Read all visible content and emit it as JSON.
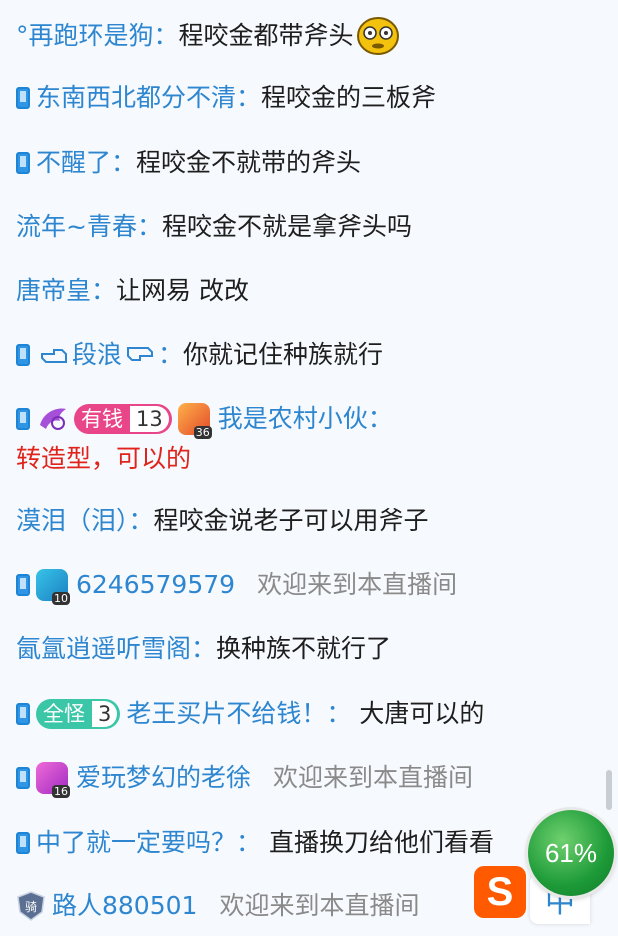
{
  "messages": [
    {
      "name": "°再跑环是狗：",
      "text": "程咬金都带斧头"
    },
    {
      "name": "东南西北都分不清：",
      "text": "程咬金的三板斧"
    },
    {
      "name": "不醒了：",
      "text": "程咬金不就带的斧头"
    },
    {
      "name": "流年~青春：",
      "text": "程咬金不就是拿斧头吗"
    },
    {
      "name": "唐帝皇：",
      "text": "让网易 改改"
    },
    {
      "name": "段浪",
      "name_suffix": "：",
      "text": "你就记住种族就行"
    },
    {
      "badge_name": "有钱",
      "badge_level": "13",
      "level_num": "36",
      "name": "我是农村小伙：",
      "text": "转造型，可以的"
    },
    {
      "name": "漠泪（泪）：",
      "text": "程咬金说老子可以用斧子"
    },
    {
      "level_num": "10",
      "name": "6246579579",
      "text": "欢迎来到本直播间"
    },
    {
      "name": "氤氲逍遥听雪阁：",
      "text": "换种族不就行了"
    },
    {
      "badge_name": "全怪",
      "badge_level": "3",
      "name": "老王买片不给钱！：",
      "text": "大唐可以的"
    },
    {
      "level_num": "16",
      "name": "爱玩梦幻的老徐",
      "text": "欢迎来到本直播间"
    },
    {
      "name": "中了就一定要吗？：",
      "text": "直播换刀给他们看看"
    },
    {
      "shield_text": "骑",
      "name": "路人880501",
      "text": "欢迎来到本直播间"
    }
  ],
  "overlay": {
    "progress_label": "61%",
    "progress_value": 61,
    "ime_label": "中",
    "sogou_label": "S"
  }
}
